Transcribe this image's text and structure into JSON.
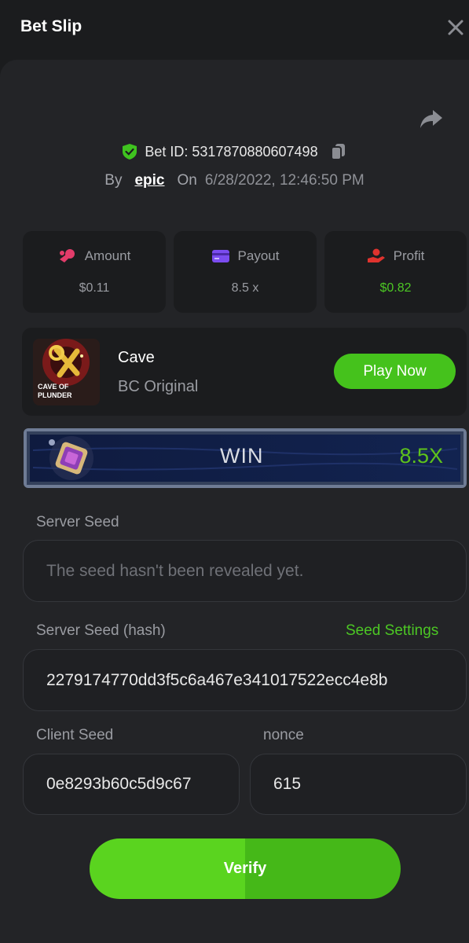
{
  "header": {
    "title": "Bet Slip"
  },
  "bet": {
    "id_text": "Bet ID: 5317870880607498",
    "by_label": "By",
    "username": "epic",
    "on_label": "On",
    "datetime": "6/28/2022, 12:46:50 PM"
  },
  "stats": [
    {
      "label": "Amount",
      "value": "$0.11",
      "icon": "coins-icon"
    },
    {
      "label": "Payout",
      "value": "8.5 x",
      "icon": "wallet-icon"
    },
    {
      "label": "Profit",
      "value": "$0.82",
      "icon": "profit-hand-icon",
      "value_color": "#4cc724"
    }
  ],
  "game": {
    "name": "Cave",
    "provider": "BC Original",
    "play_label": "Play Now",
    "thumb_text": "CAVE OF PLUNDER"
  },
  "result": {
    "text": "WIN",
    "multiplier": "8.5X"
  },
  "server_seed": {
    "label": "Server Seed",
    "placeholder": "The seed hasn't been revealed yet."
  },
  "server_seed_hash": {
    "label": "Server Seed (hash)",
    "settings_label": "Seed Settings",
    "value": "2279174770dd3f5c6a467e341017522ecc4e8b"
  },
  "client_seed": {
    "label": "Client Seed",
    "value": "0e8293b60c5d9c67"
  },
  "nonce": {
    "label": "nonce",
    "value": "615"
  },
  "verify_label": "Verify",
  "colors": {
    "accent_green": "#45c21c",
    "panel_bg": "#232427",
    "card_bg": "#1b1c1e"
  }
}
